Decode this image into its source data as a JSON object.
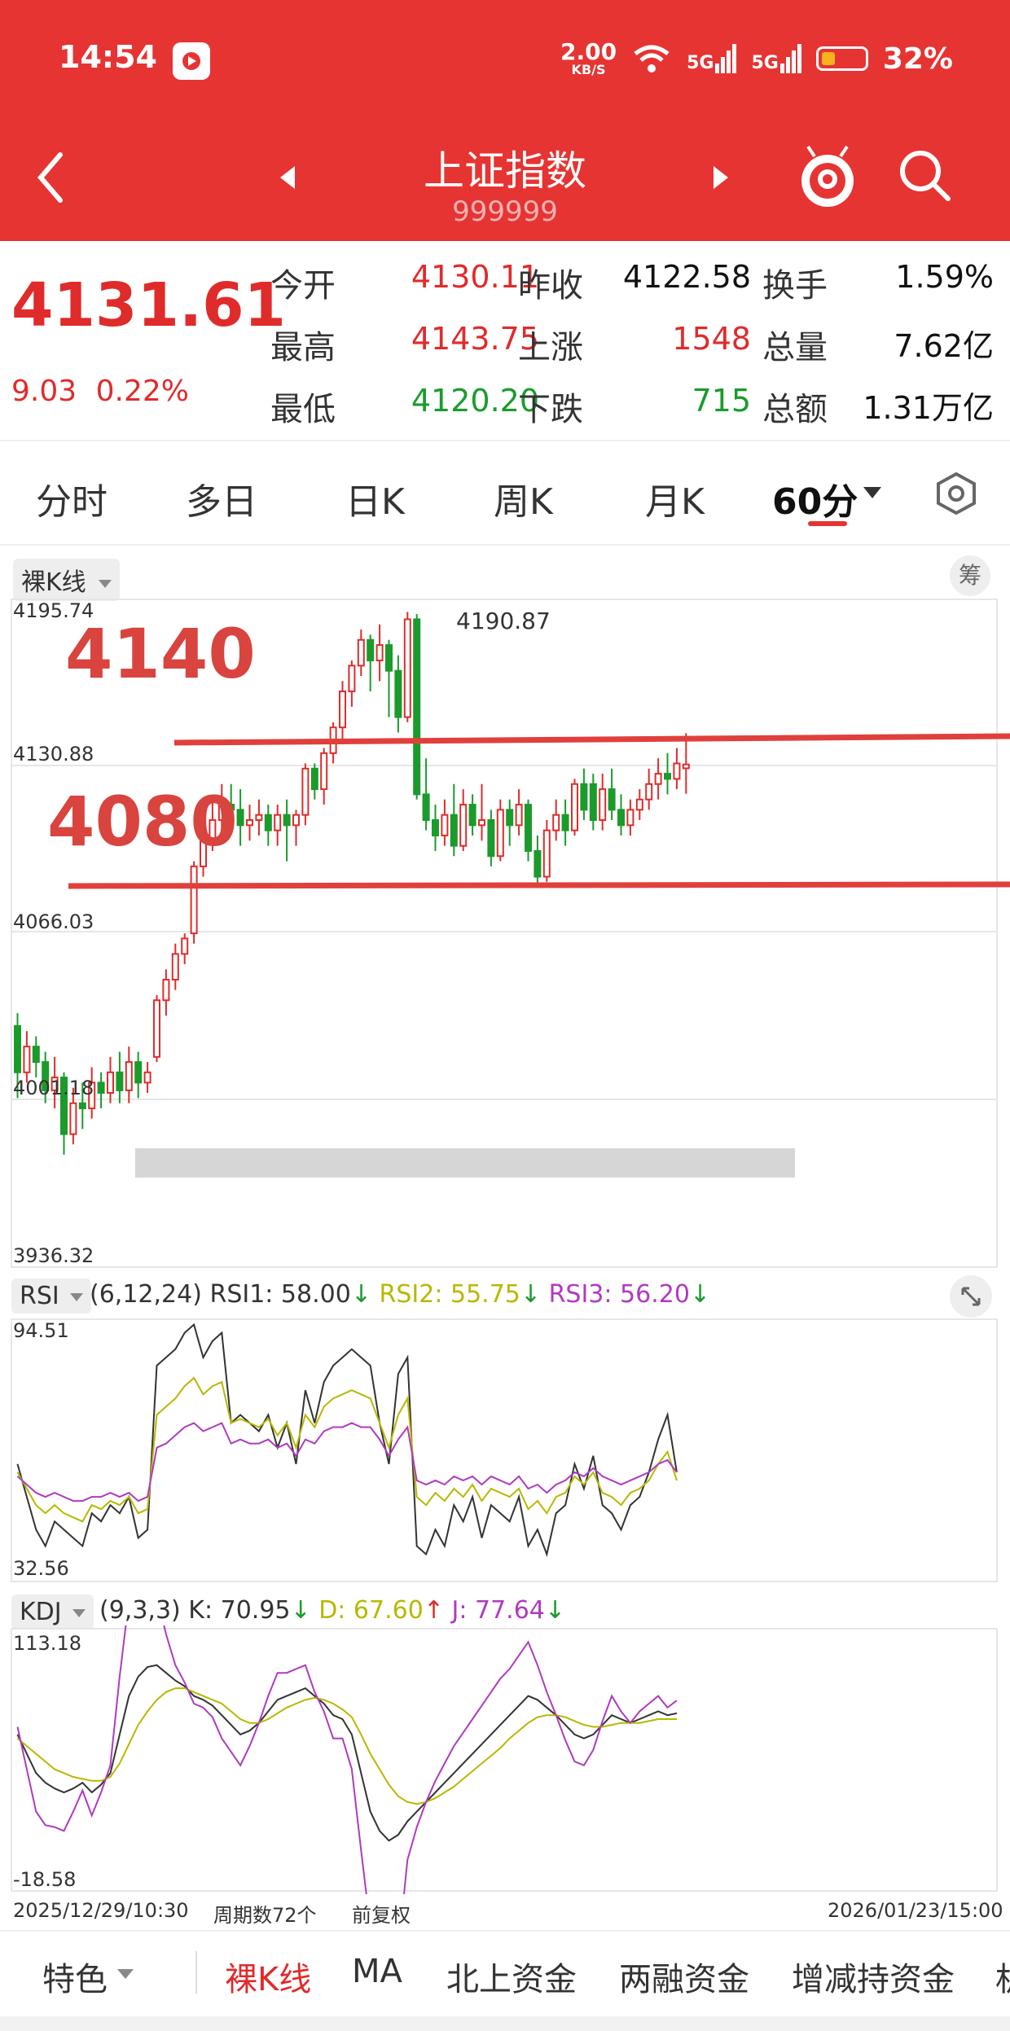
{
  "status": {
    "time": "14:54",
    "net_speed": "2.00",
    "net_unit": "KB/S",
    "sim1": "5G",
    "sim2": "5G",
    "battery": "32%"
  },
  "header": {
    "title": "上证指数",
    "code": "999999"
  },
  "quote": {
    "price": "4131.61",
    "change": "9.03",
    "change_pct": "0.22%",
    "rows": [
      {
        "l1": "今开",
        "v1": "4130.11",
        "c1": "red",
        "l2": "昨收",
        "v2": "4122.58",
        "c2": "black",
        "l3": "换手",
        "v3": "1.59%"
      },
      {
        "l1": "最高",
        "v1": "4143.75",
        "c1": "red",
        "l2": "上涨",
        "v2": "1548",
        "c2": "red",
        "l3": "总量",
        "v3": "7.62亿"
      },
      {
        "l1": "最低",
        "v1": "4120.20",
        "c1": "green",
        "l2": "下跌",
        "v2": "715",
        "c2": "green",
        "l3": "总额",
        "v3": "1.31万亿"
      }
    ]
  },
  "tabs": [
    "分时",
    "多日",
    "日K",
    "周K",
    "月K",
    "60分"
  ],
  "kline": {
    "type_label": "裸K线",
    "chip_label": "筹",
    "yticks": [
      "4195.74",
      "4130.88",
      "4066.03",
      "4001.18",
      "3936.32"
    ],
    "max_label": "4190.87",
    "annot_upper": "4140",
    "annot_lower": "4080",
    "start_date": "2025/12/29/10:30",
    "period_count": "周期数72个",
    "adjust": "前复权",
    "end_date": "2026/01/23/15:00"
  },
  "rsi": {
    "label": "RSI",
    "params": "(6,12,24)",
    "rsi1": "RSI1: 58.00",
    "rsi2": "RSI2: 55.75",
    "rsi3": "RSI3: 56.20",
    "ymax": "94.51",
    "ymin": "32.56"
  },
  "kdj": {
    "label": "KDJ",
    "params": "(9,3,3)",
    "k": "K: 70.95",
    "d": "D: 67.60",
    "j": "J: 77.64",
    "ymax": "113.18",
    "ymin": "-18.58"
  },
  "bottom_nav": [
    "特色",
    "裸K线",
    "MA",
    "北上资金",
    "两融资金",
    "增减持资金",
    "机"
  ],
  "colors": {
    "header_red": "#E63433",
    "up": "#E02B2B",
    "down": "#1A9B2C",
    "rsi2": "#B8B800",
    "rsi3": "#B03AC0"
  },
  "chart_data": {
    "type": "candlestick",
    "title": "上证指数 60分",
    "ylim": [
      3936.32,
      4195.74
    ],
    "candles": [
      {
        "o": 4030,
        "c": 4012,
        "h": 4035,
        "l": 4002
      },
      {
        "o": 4012,
        "c": 4022,
        "h": 4028,
        "l": 4008
      },
      {
        "o": 4022,
        "c": 4016,
        "h": 4026,
        "l": 4010
      },
      {
        "o": 4016,
        "c": 4005,
        "h": 4020,
        "l": 4000
      },
      {
        "o": 4005,
        "c": 4010,
        "h": 4018,
        "l": 3998
      },
      {
        "o": 4010,
        "c": 3988,
        "h": 4012,
        "l": 3980
      },
      {
        "o": 3988,
        "c": 4000,
        "h": 4006,
        "l": 3984
      },
      {
        "o": 4000,
        "c": 3998,
        "h": 4008,
        "l": 3990
      },
      {
        "o": 3998,
        "c": 4008,
        "h": 4014,
        "l": 3994
      },
      {
        "o": 4008,
        "c": 4004,
        "h": 4012,
        "l": 3998
      },
      {
        "o": 4004,
        "c": 4012,
        "h": 4018,
        "l": 4000
      },
      {
        "o": 4012,
        "c": 4005,
        "h": 4020,
        "l": 4000
      },
      {
        "o": 4005,
        "c": 4016,
        "h": 4022,
        "l": 4000
      },
      {
        "o": 4016,
        "c": 4008,
        "h": 4020,
        "l": 4002
      },
      {
        "o": 4008,
        "c": 4012,
        "h": 4016,
        "l": 4004
      },
      {
        "o": 4018,
        "c": 4040,
        "h": 4042,
        "l": 4016
      },
      {
        "o": 4040,
        "c": 4048,
        "h": 4052,
        "l": 4034
      },
      {
        "o": 4048,
        "c": 4058,
        "h": 4062,
        "l": 4044
      },
      {
        "o": 4058,
        "c": 4064,
        "h": 4066,
        "l": 4054
      },
      {
        "o": 4066,
        "c": 4092,
        "h": 4094,
        "l": 4062
      },
      {
        "o": 4092,
        "c": 4102,
        "h": 4104,
        "l": 4088
      },
      {
        "o": 4102,
        "c": 4110,
        "h": 4118,
        "l": 4098
      },
      {
        "o": 4110,
        "c": 4116,
        "h": 4124,
        "l": 4104
      },
      {
        "o": 4116,
        "c": 4114,
        "h": 4124,
        "l": 4106
      },
      {
        "o": 4114,
        "c": 4108,
        "h": 4122,
        "l": 4100
      },
      {
        "o": 4108,
        "c": 4110,
        "h": 4116,
        "l": 4102
      },
      {
        "o": 4110,
        "c": 4112,
        "h": 4118,
        "l": 4104
      },
      {
        "o": 4112,
        "c": 4106,
        "h": 4116,
        "l": 4100
      },
      {
        "o": 4106,
        "c": 4112,
        "h": 4116,
        "l": 4100
      },
      {
        "o": 4112,
        "c": 4108,
        "h": 4118,
        "l": 4094
      },
      {
        "o": 4108,
        "c": 4112,
        "h": 4114,
        "l": 4100
      },
      {
        "o": 4112,
        "c": 4130,
        "h": 4132,
        "l": 4108
      },
      {
        "o": 4130,
        "c": 4122,
        "h": 4132,
        "l": 4118
      },
      {
        "o": 4122,
        "c": 4136,
        "h": 4138,
        "l": 4116
      },
      {
        "o": 4136,
        "c": 4146,
        "h": 4148,
        "l": 4132
      },
      {
        "o": 4146,
        "c": 4160,
        "h": 4164,
        "l": 4140
      },
      {
        "o": 4160,
        "c": 4170,
        "h": 4172,
        "l": 4154
      },
      {
        "o": 4170,
        "c": 4180,
        "h": 4184,
        "l": 4166
      },
      {
        "o": 4180,
        "c": 4172,
        "h": 4182,
        "l": 4160
      },
      {
        "o": 4172,
        "c": 4178,
        "h": 4186,
        "l": 4164
      },
      {
        "o": 4178,
        "c": 4168,
        "h": 4180,
        "l": 4150
      },
      {
        "o": 4168,
        "c": 4150,
        "h": 4174,
        "l": 4144
      },
      {
        "o": 4150,
        "c": 4188,
        "h": 4190.87,
        "l": 4148
      },
      {
        "o": 4188,
        "c": 4120,
        "h": 4190,
        "l": 4118
      },
      {
        "o": 4120,
        "c": 4110,
        "h": 4134,
        "l": 4106
      },
      {
        "o": 4110,
        "c": 4104,
        "h": 4116,
        "l": 4098
      },
      {
        "o": 4104,
        "c": 4112,
        "h": 4118,
        "l": 4100
      },
      {
        "o": 4112,
        "c": 4100,
        "h": 4124,
        "l": 4096
      },
      {
        "o": 4100,
        "c": 4116,
        "h": 4122,
        "l": 4098
      },
      {
        "o": 4116,
        "c": 4108,
        "h": 4120,
        "l": 4104
      },
      {
        "o": 4108,
        "c": 4110,
        "h": 4124,
        "l": 4102
      },
      {
        "o": 4110,
        "c": 4096,
        "h": 4114,
        "l": 4092
      },
      {
        "o": 4096,
        "c": 4114,
        "h": 4118,
        "l": 4094
      },
      {
        "o": 4114,
        "c": 4108,
        "h": 4118,
        "l": 4100
      },
      {
        "o": 4108,
        "c": 4116,
        "h": 4122,
        "l": 4104
      },
      {
        "o": 4116,
        "c": 4098,
        "h": 4118,
        "l": 4094
      },
      {
        "o": 4098,
        "c": 4088,
        "h": 4104,
        "l": 4084
      },
      {
        "o": 4088,
        "c": 4106,
        "h": 4110,
        "l": 4086
      },
      {
        "o": 4106,
        "c": 4112,
        "h": 4118,
        "l": 4102
      },
      {
        "o": 4112,
        "c": 4106,
        "h": 4118,
        "l": 4100
      },
      {
        "o": 4106,
        "c": 4124,
        "h": 4126,
        "l": 4104
      },
      {
        "o": 4124,
        "c": 4114,
        "h": 4130,
        "l": 4110
      },
      {
        "o": 4124,
        "c": 4110,
        "h": 4128,
        "l": 4106
      },
      {
        "o": 4110,
        "c": 4122,
        "h": 4128,
        "l": 4106
      },
      {
        "o": 4122,
        "c": 4114,
        "h": 4130,
        "l": 4110
      },
      {
        "o": 4114,
        "c": 4108,
        "h": 4120,
        "l": 4104
      },
      {
        "o": 4108,
        "c": 4114,
        "h": 4118,
        "l": 4104
      },
      {
        "o": 4114,
        "c": 4118,
        "h": 4122,
        "l": 4110
      },
      {
        "o": 4118,
        "c": 4124,
        "h": 4130,
        "l": 4114
      },
      {
        "o": 4124,
        "c": 4128,
        "h": 4134,
        "l": 4118
      },
      {
        "o": 4128,
        "c": 4126,
        "h": 4136,
        "l": 4120
      },
      {
        "o": 4126,
        "c": 4132,
        "h": 4138,
        "l": 4122
      },
      {
        "o": 4130.11,
        "c": 4131.61,
        "h": 4143.75,
        "l": 4120.2
      }
    ],
    "rsi_series": [
      {
        "name": "RSI1",
        "values": [
          60,
          52,
          44,
          40,
          46,
          44,
          42,
          40,
          48,
          46,
          50,
          48,
          52,
          42,
          44,
          84,
          86,
          88,
          92,
          94,
          86,
          90,
          92,
          70,
          72,
          70,
          68,
          72,
          64,
          70,
          60,
          78,
          70,
          80,
          84,
          86,
          88,
          86,
          84,
          70,
          60,
          82,
          86,
          40,
          38,
          44,
          40,
          50,
          46,
          52,
          42,
          50,
          48,
          46,
          52,
          40,
          44,
          38,
          48,
          50,
          60,
          54,
          62,
          50,
          48,
          44,
          50,
          52,
          58,
          66,
          72,
          58
        ]
      },
      {
        "name": "RSI2",
        "values": [
          58,
          54,
          50,
          48,
          50,
          48,
          47,
          46,
          50,
          49,
          51,
          50,
          52,
          48,
          49,
          72,
          74,
          76,
          79,
          81,
          77,
          79,
          80,
          70,
          71,
          70,
          69,
          71,
          67,
          70,
          64,
          72,
          69,
          74,
          76,
          77,
          78,
          77,
          76,
          70,
          64,
          72,
          76,
          52,
          50,
          53,
          51,
          54,
          52,
          55,
          51,
          54,
          53,
          52,
          54,
          49,
          51,
          48,
          52,
          53,
          57,
          55,
          58,
          53,
          52,
          50,
          53,
          54,
          56,
          60,
          63,
          56
        ]
      },
      {
        "name": "RSI3",
        "values": [
          57,
          55,
          53,
          52,
          53,
          52,
          51,
          51,
          52,
          52,
          53,
          52,
          53,
          51,
          52,
          64,
          65,
          67,
          69,
          70,
          68,
          69,
          70,
          65,
          66,
          65,
          65,
          66,
          64,
          65,
          62,
          66,
          65,
          68,
          69,
          69,
          70,
          69,
          69,
          66,
          62,
          66,
          69,
          56,
          55,
          56,
          55,
          57,
          56,
          57,
          55,
          57,
          56,
          55,
          57,
          54,
          55,
          53,
          55,
          56,
          58,
          57,
          59,
          57,
          56,
          55,
          56,
          57,
          58,
          60,
          61,
          58
        ]
      }
    ],
    "kdj_series": [
      {
        "name": "K",
        "values": [
          60,
          50,
          40,
          35,
          32,
          30,
          32,
          35,
          30,
          34,
          40,
          60,
          80,
          90,
          95,
          96,
          92,
          88,
          85,
          80,
          78,
          75,
          70,
          65,
          60,
          62,
          66,
          72,
          78,
          80,
          82,
          84,
          80,
          76,
          70,
          68,
          60,
          40,
          20,
          10,
          5,
          8,
          15,
          20,
          25,
          30,
          35,
          40,
          45,
          50,
          55,
          60,
          65,
          70,
          75,
          80,
          78,
          74,
          70,
          65,
          60,
          58,
          60,
          65,
          70,
          68,
          66,
          68,
          70,
          72,
          70,
          71
        ]
      },
      {
        "name": "D",
        "values": [
          58,
          54,
          50,
          46,
          42,
          40,
          38,
          37,
          36,
          36,
          38,
          45,
          55,
          65,
          72,
          78,
          82,
          84,
          84,
          82,
          80,
          78,
          76,
          72,
          68,
          66,
          66,
          68,
          71,
          74,
          76,
          78,
          79,
          78,
          76,
          73,
          69,
          60,
          50,
          42,
          34,
          28,
          25,
          24,
          25,
          27,
          30,
          33,
          37,
          41,
          45,
          49,
          53,
          58,
          62,
          66,
          69,
          70,
          70,
          69,
          67,
          65,
          64,
          64,
          65,
          66,
          66,
          66,
          67,
          68,
          68,
          68
        ]
      },
      {
        "name": "J",
        "values": [
          64,
          42,
          20,
          13,
          12,
          10,
          20,
          31,
          18,
          30,
          44,
          90,
          130,
          140,
          141,
          132,
          112,
          96,
          87,
          76,
          74,
          69,
          58,
          51,
          44,
          54,
          66,
          80,
          92,
          92,
          94,
          96,
          82,
          72,
          58,
          58,
          42,
          0,
          -40,
          -54,
          -63,
          -52,
          -5,
          12,
          25,
          36,
          45,
          54,
          61,
          68,
          75,
          82,
          89,
          94,
          101,
          108,
          96,
          82,
          70,
          57,
          46,
          44,
          52,
          67,
          80,
          72,
          66,
          72,
          76,
          80,
          74,
          77.64
        ]
      }
    ]
  }
}
